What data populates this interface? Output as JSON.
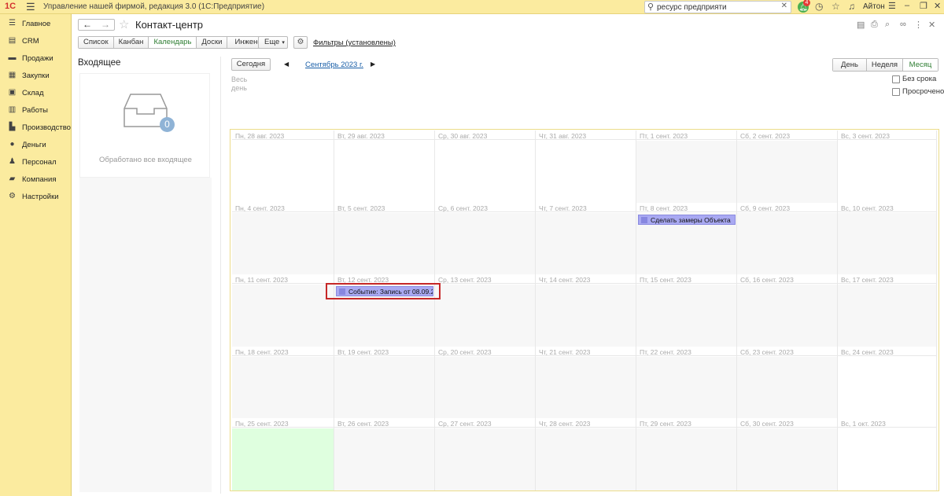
{
  "app": {
    "title": "Управление нашей фирмой, редакция 3.0  (1С:Предприятие)",
    "logo": "1С",
    "search_value": "ресурс предприяти",
    "notifications_count": "4",
    "user": "Айтон"
  },
  "sidebar": {
    "items": [
      {
        "label": "Главное",
        "icon": "menu-icon"
      },
      {
        "label": "CRM",
        "icon": "crm-icon"
      },
      {
        "label": "Продажи",
        "icon": "sales-icon"
      },
      {
        "label": "Закупки",
        "icon": "cart-icon"
      },
      {
        "label": "Склад",
        "icon": "warehouse-icon"
      },
      {
        "label": "Работы",
        "icon": "works-icon"
      },
      {
        "label": "Производство",
        "icon": "factory-icon"
      },
      {
        "label": "Деньги",
        "icon": "money-icon"
      },
      {
        "label": "Персонал",
        "icon": "person-icon"
      },
      {
        "label": "Компания",
        "icon": "company-icon"
      },
      {
        "label": "Настройки",
        "icon": "gear-icon"
      }
    ]
  },
  "header": {
    "title": "Контакт-центр"
  },
  "toolbar": {
    "tabs": [
      "Список",
      "Канбан",
      "Календарь",
      "Доски",
      "Инженеры"
    ],
    "active_tab": "Календарь",
    "more_label": "Еще",
    "filters_link": "Фильтры (установлены)"
  },
  "inbox": {
    "title": "Входящее",
    "count": "0",
    "empty_text": "Обработано все входящее"
  },
  "calendar": {
    "today_label": "Сегодня",
    "month_label": "Сентябрь 2023 г.",
    "allday_label": "Весь день",
    "periods": [
      "День",
      "Неделя",
      "Месяц"
    ],
    "active_period": "Месяц",
    "checkboxes": [
      {
        "label": "Без срока",
        "checked": false
      },
      {
        "label": "Просрочено",
        "checked": false
      }
    ],
    "weeks": [
      [
        "Пн, 28 авг. 2023",
        "Вт, 29 авг. 2023",
        "Ср, 30 авг. 2023",
        "Чт, 31 авг. 2023",
        "Пт, 1 сент. 2023",
        "Сб, 2 сент. 2023",
        "Вс, 3 сент. 2023"
      ],
      [
        "Пн, 4 сент. 2023",
        "Вт, 5 сент. 2023",
        "Ср, 6 сент. 2023",
        "Чт, 7 сент. 2023",
        "Пт, 8 сент. 2023",
        "Сб, 9 сент. 2023",
        "Вс, 10 сент. 2023"
      ],
      [
        "Пн, 11 сент. 2023",
        "Вт, 12 сент. 2023",
        "Ср, 13 сент. 2023",
        "Чт, 14 сент. 2023",
        "Пт, 15 сент. 2023",
        "Сб, 16 сент. 2023",
        "Вс, 17 сент. 2023"
      ],
      [
        "Пн, 18 сент. 2023",
        "Вт, 19 сент. 2023",
        "Ср, 20 сент. 2023",
        "Чт, 21 сент. 2023",
        "Пт, 22 сент. 2023",
        "Сб, 23 сент. 2023",
        "Вс, 24 сент. 2023"
      ],
      [
        "Пн, 25 сент. 2023",
        "Вт, 26 сент. 2023",
        "Ср, 27 сент. 2023",
        "Чт, 28 сент. 2023",
        "Пт, 29 сент. 2023",
        "Сб, 30 сент. 2023",
        "Вс, 1 окт. 2023"
      ]
    ],
    "events": [
      {
        "text": "Сделать замеры Объекта",
        "week": 1,
        "day": 4
      },
      {
        "text": "Событие: Запись от 08.09.2023",
        "week": 2,
        "day": 1
      }
    ]
  }
}
